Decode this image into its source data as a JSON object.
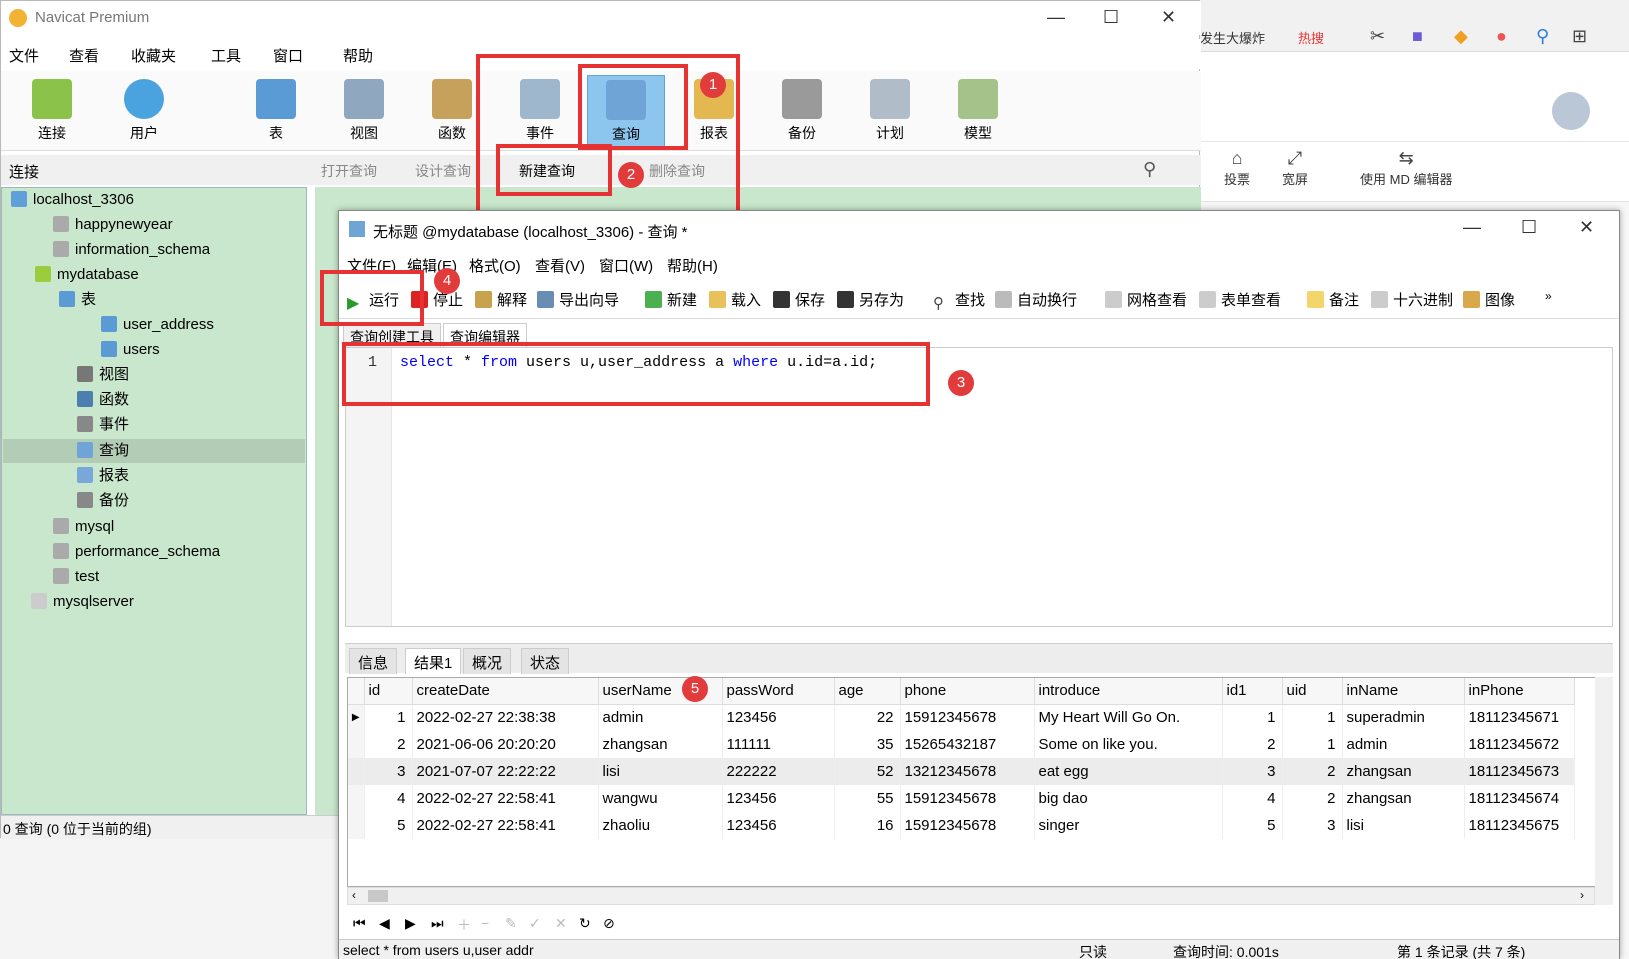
{
  "app": {
    "title": "Navicat Premium",
    "menu": [
      "文件",
      "查看",
      "收藏夹",
      "工具",
      "窗口",
      "帮助"
    ],
    "ribbon": [
      {
        "label": "连接",
        "icon": "connection-icon"
      },
      {
        "label": "用户",
        "icon": "user-icon"
      },
      {
        "label": "表",
        "icon": "table-icon"
      },
      {
        "label": "视图",
        "icon": "view-icon"
      },
      {
        "label": "函数",
        "icon": "function-icon"
      },
      {
        "label": "事件",
        "icon": "event-icon"
      },
      {
        "label": "查询",
        "icon": "query-icon",
        "active": true
      },
      {
        "label": "报表",
        "icon": "report-icon"
      },
      {
        "label": "备份",
        "icon": "backup-icon"
      },
      {
        "label": "计划",
        "icon": "schedule-icon"
      },
      {
        "label": "模型",
        "icon": "model-icon"
      }
    ],
    "conn_header": "连接",
    "object_toolbar": [
      "打开查询",
      "设计查询",
      "新建查询",
      "删除查询"
    ],
    "status": "0 查询 (0 位于当前的组)"
  },
  "tree": [
    {
      "label": "localhost_3306",
      "level": 0
    },
    {
      "label": "happynewyear",
      "level": 1
    },
    {
      "label": "information_schema",
      "level": 1
    },
    {
      "label": "mydatabase",
      "level": 1
    },
    {
      "label": "表",
      "level": 2
    },
    {
      "label": "user_address",
      "level": 3
    },
    {
      "label": "users",
      "level": 3
    },
    {
      "label": "视图",
      "level": 2
    },
    {
      "label": "函数",
      "level": 2
    },
    {
      "label": "事件",
      "level": 2
    },
    {
      "label": "查询",
      "level": 2,
      "selected": true
    },
    {
      "label": "报表",
      "level": 2
    },
    {
      "label": "备份",
      "level": 2
    },
    {
      "label": "mysql",
      "level": 1
    },
    {
      "label": "performance_schema",
      "level": 1
    },
    {
      "label": "test",
      "level": 1
    },
    {
      "label": "mysqlserver",
      "level": 0
    }
  ],
  "browser": {
    "text1": "发生大爆炸",
    "text2": "热搜",
    "tools": [
      "投票",
      "宽屏",
      "使用 MD 编辑器"
    ]
  },
  "query_window": {
    "title": "无标题 @mydatabase (localhost_3306) - 查询 *",
    "menu": [
      "文件(F)",
      "编辑(E)",
      "格式(O)",
      "查看(V)",
      "窗口(W)",
      "帮助(H)"
    ],
    "toolbar": [
      "运行",
      "停止",
      "解释",
      "导出向导",
      "新建",
      "载入",
      "保存",
      "另存为",
      "查找",
      "自动换行",
      "网格查看",
      "表单查看",
      "备注",
      "十六进制",
      "图像"
    ],
    "tabs": [
      "查询创建工具",
      "查询编辑器"
    ],
    "line_no": "1",
    "sql": {
      "kw1": "select",
      "t1": " * ",
      "kw2": "from",
      "t2": " users u,user_address a ",
      "kw3": "where",
      "t3": " u.id=a.id;"
    },
    "result_tabs": [
      "信息",
      "结果1",
      "概况",
      "状态"
    ],
    "columns": [
      "id",
      "createDate",
      "userName",
      "passWord",
      "age",
      "phone",
      "introduce",
      "id1",
      "uid",
      "inName",
      "inPhone"
    ],
    "rows": [
      [
        "1",
        "2022-02-27 22:38:38",
        "admin",
        "123456",
        "22",
        "15912345678",
        "My Heart Will Go On.",
        "1",
        "1",
        "superadmin",
        "18112345671"
      ],
      [
        "2",
        "2021-06-06 20:20:20",
        "zhangsan",
        "111111",
        "35",
        "15265432187",
        "Some on like you.",
        "2",
        "1",
        "admin",
        "18112345672"
      ],
      [
        "3",
        "2021-07-07 22:22:22",
        "lisi",
        "222222",
        "52",
        "13212345678",
        "eat egg",
        "3",
        "2",
        "zhangsan",
        "18112345673"
      ],
      [
        "4",
        "2022-02-27 22:58:41",
        "wangwu",
        "123456",
        "55",
        "15912345678",
        "big dao",
        "4",
        "2",
        "zhangsan",
        "18112345674"
      ],
      [
        "5",
        "2022-02-27 22:58:41",
        "zhaoliu",
        "123456",
        "16",
        "15912345678",
        "singer",
        "5",
        "3",
        "lisi",
        "18112345675"
      ]
    ],
    "status": {
      "sql": "select * from users u,user addr",
      "mode": "只读",
      "time": "查询时间: 0.001s",
      "record": "第 1 条记录 (共 7 条)"
    }
  },
  "badges": [
    "1",
    "2",
    "3",
    "4",
    "5"
  ],
  "colors": {
    "annotation_red": "#e53333",
    "tree_bg": "#c9e7cc",
    "keyword_blue": "#0000ff"
  }
}
